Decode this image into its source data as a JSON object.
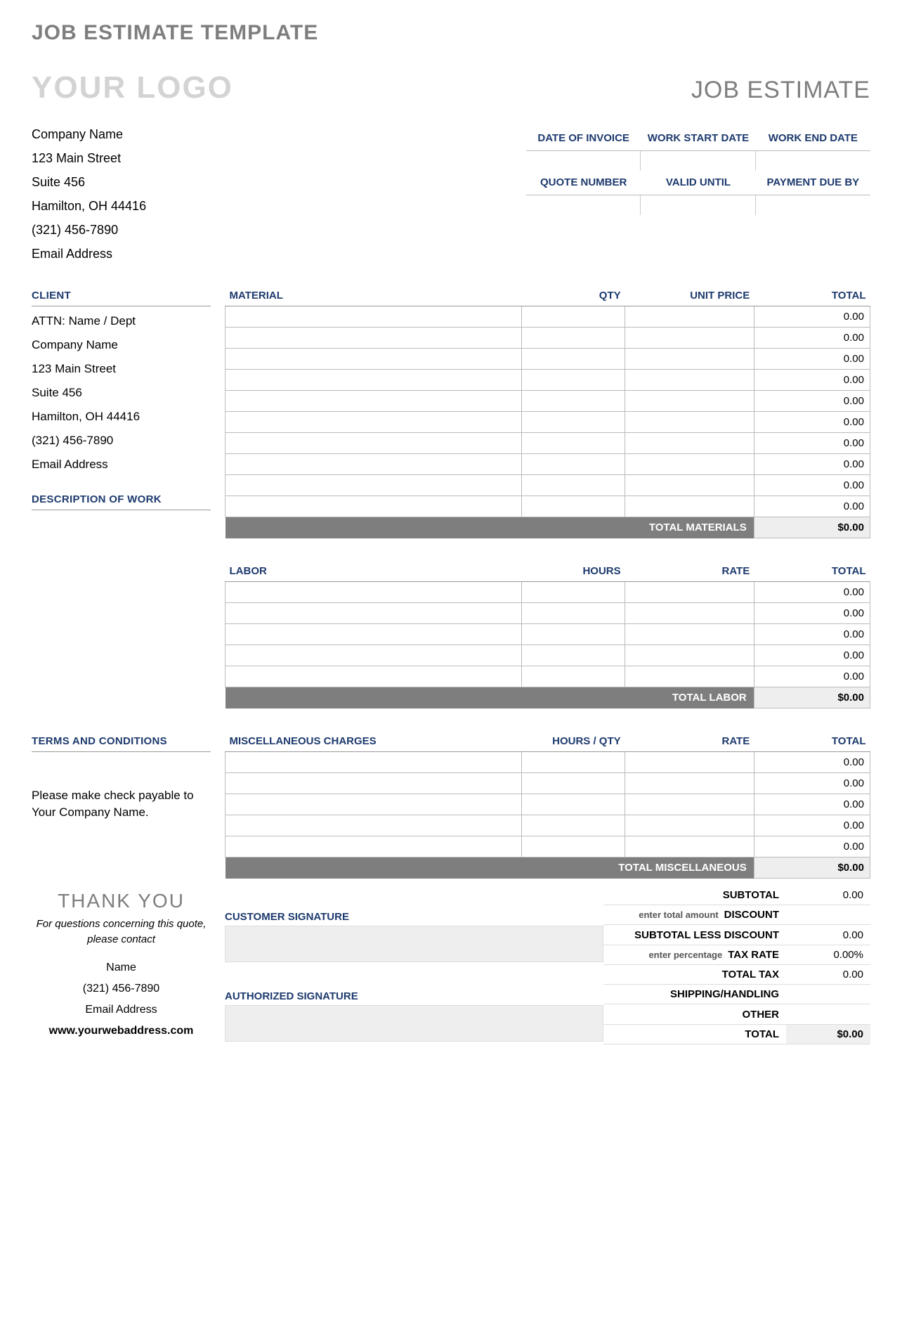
{
  "page_title": "JOB ESTIMATE TEMPLATE",
  "logo_text": "YOUR LOGO",
  "doc_type": "JOB ESTIMATE",
  "company": {
    "name": "Company Name",
    "street": "123 Main Street",
    "suite": "Suite 456",
    "city": "Hamilton, OH  44416",
    "phone": "(321) 456-7890",
    "email": "Email Address"
  },
  "meta_headers_row1": [
    "DATE OF INVOICE",
    "WORK START DATE",
    "WORK END DATE"
  ],
  "meta_headers_row2": [
    "QUOTE NUMBER",
    "VALID UNTIL",
    "PAYMENT DUE BY"
  ],
  "client_header": "CLIENT",
  "client": {
    "attn": "ATTN: Name / Dept",
    "company": "Company Name",
    "street": "123 Main Street",
    "suite": "Suite 456",
    "city": "Hamilton, OH  44416",
    "phone": "(321) 456-7890",
    "email": "Email Address"
  },
  "description_header": "DESCRIPTION OF WORK",
  "materials": {
    "headers": [
      "MATERIAL",
      "QTY",
      "UNIT PRICE",
      "TOTAL"
    ],
    "rows": [
      "0.00",
      "0.00",
      "0.00",
      "0.00",
      "0.00",
      "0.00",
      "0.00",
      "0.00",
      "0.00",
      "0.00"
    ],
    "total_label": "TOTAL MATERIALS",
    "total_value": "$0.00"
  },
  "labor": {
    "headers": [
      "LABOR",
      "HOURS",
      "RATE",
      "TOTAL"
    ],
    "rows": [
      "0.00",
      "0.00",
      "0.00",
      "0.00",
      "0.00"
    ],
    "total_label": "TOTAL LABOR",
    "total_value": "$0.00"
  },
  "terms_header": "TERMS AND CONDITIONS",
  "terms_text": "Please make check payable to Your Company Name.",
  "misc": {
    "headers": [
      "MISCELLANEOUS CHARGES",
      "HOURS / QTY",
      "RATE",
      "TOTAL"
    ],
    "rows": [
      "0.00",
      "0.00",
      "0.00",
      "0.00",
      "0.00"
    ],
    "total_label": "TOTAL MISCELLANEOUS",
    "total_value": "$0.00"
  },
  "summary": {
    "subtotal_label": "SUBTOTAL",
    "subtotal_val": "0.00",
    "discount_hint": "enter total amount",
    "discount_label": "DISCOUNT",
    "discount_val": "",
    "subtotal_less_label": "SUBTOTAL LESS DISCOUNT",
    "subtotal_less_val": "0.00",
    "taxrate_hint": "enter percentage",
    "taxrate_label": "TAX RATE",
    "taxrate_val": "0.00%",
    "totaltax_label": "TOTAL TAX",
    "totaltax_val": "0.00",
    "shipping_label": "SHIPPING/HANDLING",
    "shipping_val": "",
    "other_label": "OTHER",
    "other_val": "",
    "total_label": "TOTAL",
    "total_val": "$0.00"
  },
  "customer_sig_label": "CUSTOMER SIGNATURE",
  "authorized_sig_label": "AUTHORIZED SIGNATURE",
  "thank_you": "THANK YOU",
  "contact_note": "For questions concerning this quote, please contact",
  "contact": {
    "name": "Name",
    "phone": "(321) 456-7890",
    "email": "Email Address",
    "web": "www.yourwebaddress.com"
  }
}
